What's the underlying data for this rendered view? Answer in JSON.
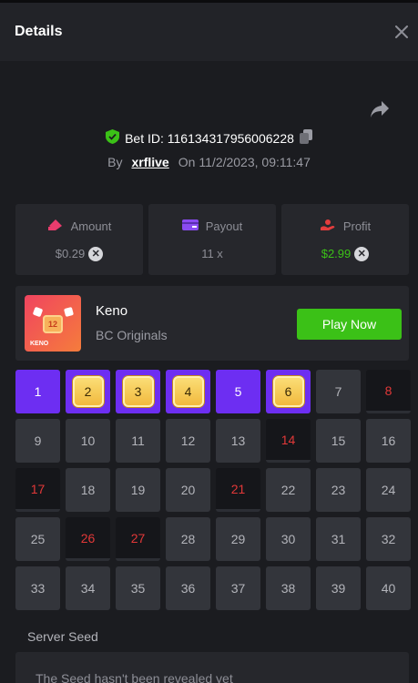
{
  "header": {
    "title": "Details"
  },
  "bet": {
    "id_text": "Bet ID: 116134317956006228",
    "by_label": "By",
    "user": "xrflive",
    "on_label": "On",
    "datetime": "11/2/2023, 09:11:47"
  },
  "stats": [
    {
      "label": "Amount",
      "value": "$0.29",
      "icon": "amount-icon",
      "color": "#ea3c6d"
    },
    {
      "label": "Payout",
      "value": "11 x",
      "icon": "payout-wallet-icon",
      "color": "#8a4bf2"
    },
    {
      "label": "Profit",
      "value": "$2.99",
      "icon": "profit-icon",
      "color": "#e43d3d"
    }
  ],
  "game": {
    "name": "Keno",
    "provider": "BC Originals",
    "thumb_number": "12",
    "thumb_label": "KENO",
    "play_label": "Play Now"
  },
  "board": {
    "cells": [
      {
        "n": "1",
        "s": "sel"
      },
      {
        "n": "2",
        "s": "hit"
      },
      {
        "n": "3",
        "s": "hit"
      },
      {
        "n": "4",
        "s": "hit"
      },
      {
        "n": "5",
        "s": "sel"
      },
      {
        "n": "6",
        "s": "hit"
      },
      {
        "n": "7",
        "s": ""
      },
      {
        "n": "8",
        "s": "miss"
      },
      {
        "n": "9",
        "s": ""
      },
      {
        "n": "10",
        "s": ""
      },
      {
        "n": "11",
        "s": ""
      },
      {
        "n": "12",
        "s": ""
      },
      {
        "n": "13",
        "s": ""
      },
      {
        "n": "14",
        "s": "miss"
      },
      {
        "n": "15",
        "s": ""
      },
      {
        "n": "16",
        "s": ""
      },
      {
        "n": "17",
        "s": "miss"
      },
      {
        "n": "18",
        "s": ""
      },
      {
        "n": "19",
        "s": ""
      },
      {
        "n": "20",
        "s": ""
      },
      {
        "n": "21",
        "s": "miss"
      },
      {
        "n": "22",
        "s": ""
      },
      {
        "n": "23",
        "s": ""
      },
      {
        "n": "24",
        "s": ""
      },
      {
        "n": "25",
        "s": ""
      },
      {
        "n": "26",
        "s": "miss"
      },
      {
        "n": "27",
        "s": "miss"
      },
      {
        "n": "28",
        "s": ""
      },
      {
        "n": "29",
        "s": ""
      },
      {
        "n": "30",
        "s": ""
      },
      {
        "n": "31",
        "s": ""
      },
      {
        "n": "32",
        "s": ""
      },
      {
        "n": "33",
        "s": ""
      },
      {
        "n": "34",
        "s": ""
      },
      {
        "n": "35",
        "s": ""
      },
      {
        "n": "36",
        "s": ""
      },
      {
        "n": "37",
        "s": ""
      },
      {
        "n": "38",
        "s": ""
      },
      {
        "n": "39",
        "s": ""
      },
      {
        "n": "40",
        "s": ""
      }
    ]
  },
  "seed": {
    "label": "Server Seed",
    "text": "The Seed hasn't been revealed yet"
  },
  "colors": {
    "accent_purple": "#6d2ef2",
    "green": "#3bc117",
    "miss_red": "#e23838"
  }
}
